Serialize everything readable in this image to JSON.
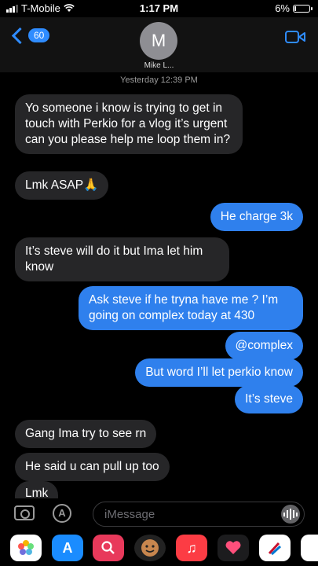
{
  "status_bar": {
    "carrier": "T-Mobile",
    "time": "1:17 PM",
    "battery": "6%"
  },
  "header": {
    "back_count": "60",
    "avatar_initial": "M",
    "contact_name": "Mike L..."
  },
  "timestamp": "Yesterday 12:39 PM",
  "messages": [
    {
      "from": "them",
      "text": "Yo someone i know is trying to get in touch with Perkio for a vlog it’s urgent can you please help me loop them in?"
    },
    {
      "from": "them",
      "text": "Lmk ASAP🙏"
    },
    {
      "from": "me",
      "text": "He charge 3k"
    },
    {
      "from": "them",
      "text": "It’s steve will do it but Ima let him know"
    },
    {
      "from": "me",
      "text": "Ask steve if he tryna have me ? I’m going on complex today at 430"
    },
    {
      "from": "me",
      "text": "@complex"
    },
    {
      "from": "me",
      "text": "But word I’ll let perkio know"
    },
    {
      "from": "me",
      "text": "It’s steve"
    },
    {
      "from": "them",
      "text": "Gang Ima try to see rn"
    },
    {
      "from": "them",
      "text": "He said u can pull up too"
    },
    {
      "from": "them",
      "text": "Lmk"
    }
  ],
  "input": {
    "placeholder": "iMessage"
  },
  "app_drawer": [
    "photos-app-icon",
    "app-store-icon",
    "images-search-icon",
    "memoji-icon",
    "music-icon",
    "digital-touch-icon",
    "airline-app-icon",
    "more-app-icon"
  ],
  "colors": {
    "bubble_out": "#2f80ed",
    "bubble_in": "#262628",
    "accent": "#2f8cff"
  }
}
